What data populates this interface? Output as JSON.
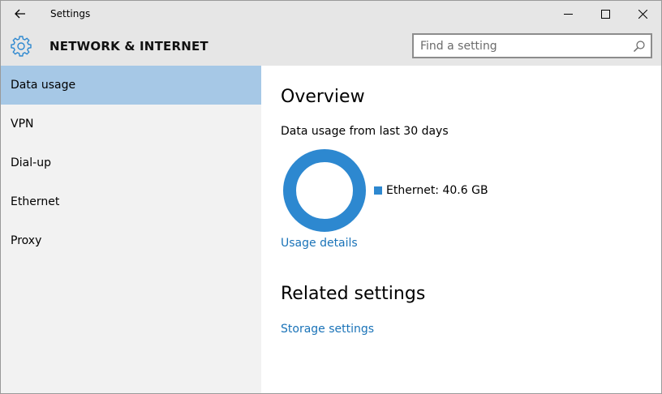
{
  "window": {
    "title": "Settings"
  },
  "header": {
    "section_title": "NETWORK & INTERNET",
    "search_placeholder": "Find a setting",
    "icon": "gear-icon"
  },
  "sidebar": {
    "items": [
      {
        "label": "Data usage",
        "active": true
      },
      {
        "label": "VPN",
        "active": false
      },
      {
        "label": "Dial-up",
        "active": false
      },
      {
        "label": "Ethernet",
        "active": false
      },
      {
        "label": "Proxy",
        "active": false
      }
    ]
  },
  "main": {
    "overview_heading": "Overview",
    "usage_caption": "Data usage from last 30 days",
    "usage_details_link": "Usage details",
    "related_heading": "Related settings",
    "storage_link": "Storage settings"
  },
  "chart_data": {
    "type": "pie",
    "title": "",
    "series": [
      {
        "name": "Ethernet",
        "value": 40.6,
        "unit": "GB",
        "label": "Ethernet: 40.6 GB",
        "color": "#2d88d0"
      }
    ]
  },
  "colors": {
    "accent": "#2d88d0",
    "link": "#1a73b8",
    "sidebar_active": "#a6c8e6",
    "sidebar_bg": "#f2f2f2",
    "titlebar_bg": "#e6e6e6"
  }
}
